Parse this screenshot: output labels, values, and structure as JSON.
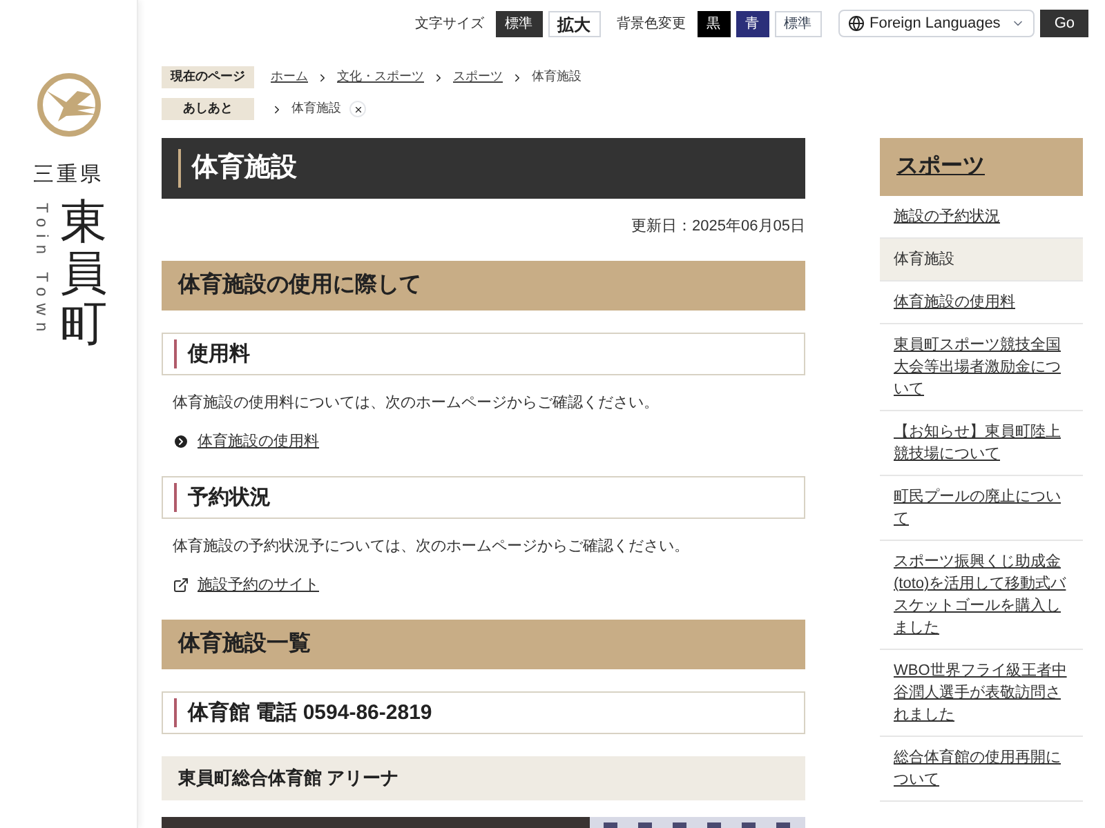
{
  "logo": {
    "prefecture": "三重県",
    "romaji": "Toin Town",
    "town": "東員町"
  },
  "toolbar": {
    "font_size_label": "文字サイズ",
    "font_sizes": [
      {
        "label": "標準",
        "selected": true
      },
      {
        "label": "拡大",
        "selected": false
      }
    ],
    "bg_label": "背景色変更",
    "bg_colors": [
      {
        "label": "黒",
        "kind": "black"
      },
      {
        "label": "青",
        "kind": "blue"
      },
      {
        "label": "標準",
        "kind": "default"
      }
    ],
    "language": "Foreign Languages",
    "go": "Go"
  },
  "breadcrumb": {
    "label": "現在のページ",
    "items": [
      {
        "text": "ホーム",
        "link": true
      },
      {
        "text": "文化・スポーツ",
        "link": true
      },
      {
        "text": "スポーツ",
        "link": true
      },
      {
        "text": "体育施設",
        "link": false
      }
    ]
  },
  "history": {
    "label": "あしあと",
    "items": [
      "体育施設"
    ]
  },
  "page_title": "体育施設",
  "updated": "更新日：2025年06月05日",
  "sections": [
    {
      "kind": "h2",
      "text": "体育施設の使用に際して"
    },
    {
      "kind": "h3",
      "text": "使用料"
    },
    {
      "kind": "p",
      "text": "体育施設の使用料については、次のホームページからご確認ください。"
    },
    {
      "kind": "link",
      "text": "体育施設の使用料"
    },
    {
      "kind": "h3",
      "text": "予約状況"
    },
    {
      "kind": "p",
      "text": "体育施設の予約状況予については、次のホームページからご確認ください。"
    },
    {
      "kind": "external",
      "text": "施設予約のサイト"
    },
    {
      "kind": "h2",
      "text": "体育施設一覧"
    },
    {
      "kind": "h3",
      "text": "体育館 電話 0594-86-2819"
    },
    {
      "kind": "h4",
      "text": "東員町総合体育館 アリーナ"
    },
    {
      "kind": "picture"
    }
  ],
  "side_nav": {
    "title": "スポーツ",
    "items": [
      {
        "text": "施設の予約状況",
        "selected": false
      },
      {
        "text": "体育施設",
        "selected": true
      },
      {
        "text": "体育施設の使用料",
        "selected": false
      },
      {
        "text": "東員町スポーツ競技全国大会等出場者激励金について",
        "selected": false
      },
      {
        "text": "【お知らせ】東員町陸上競技場について",
        "selected": false
      },
      {
        "text": "町民プールの廃止について",
        "selected": false
      },
      {
        "text": "スポーツ振興くじ助成金(toto)を活用して移動式バスケットゴールを購入しました",
        "selected": false
      },
      {
        "text": "WBO世界フライ級王者中谷潤人選手が表敬訪問されました",
        "selected": false
      },
      {
        "text": "総合体育館の使用再開について",
        "selected": false
      }
    ]
  }
}
